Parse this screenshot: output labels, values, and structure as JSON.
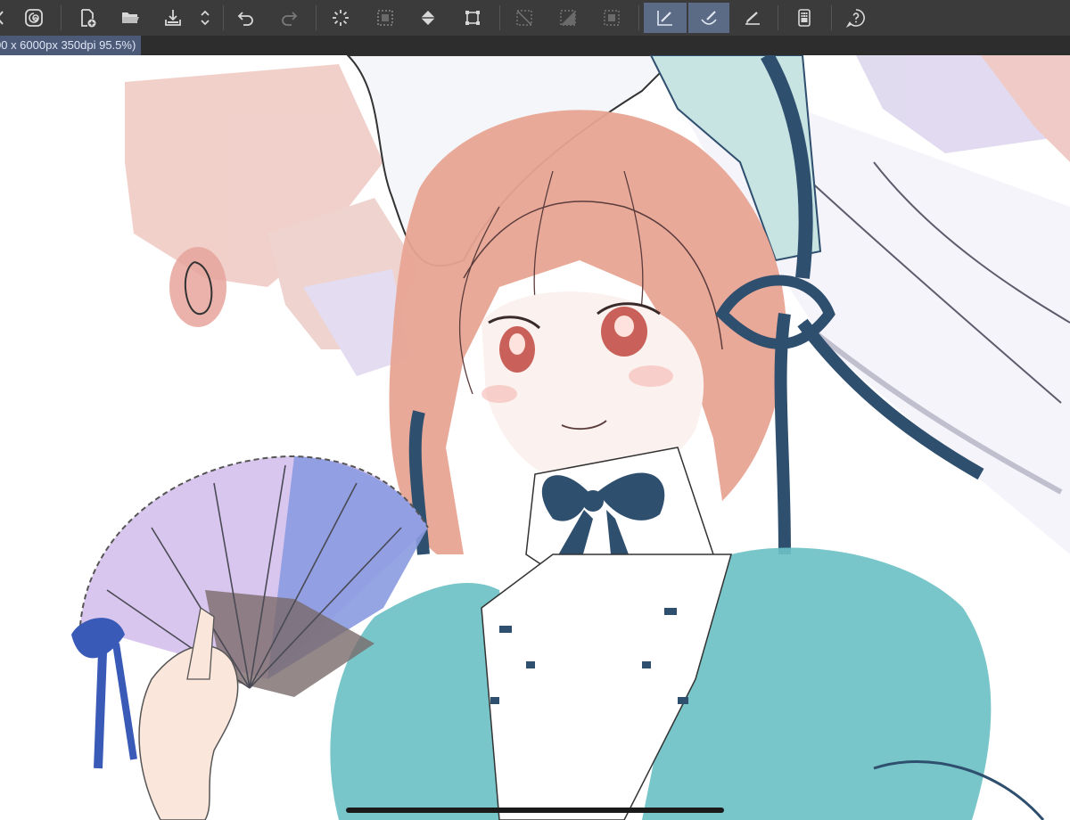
{
  "toolbar": {
    "buttons": [
      {
        "name": "clip-studio-icon",
        "label": "Clip Studio"
      },
      {
        "name": "new-file-icon",
        "label": "New"
      },
      {
        "name": "open-folder-icon",
        "label": "Open"
      },
      {
        "name": "save-icon",
        "label": "Save"
      },
      {
        "name": "undo-icon",
        "label": "Undo"
      },
      {
        "name": "redo-icon",
        "label": "Redo"
      },
      {
        "name": "clear-selection-icon",
        "label": "Clear"
      },
      {
        "name": "select-all-icon",
        "label": "Select all"
      },
      {
        "name": "fill-icon",
        "label": "Fill"
      },
      {
        "name": "transform-icon",
        "label": "Transform"
      },
      {
        "name": "snap-off-icon",
        "label": "Snap off"
      },
      {
        "name": "snap-ruler-icon",
        "label": "Snap to ruler"
      },
      {
        "name": "snap-grid-icon",
        "label": "Snap to grid"
      },
      {
        "name": "pen-pressure-icon",
        "label": "Pen"
      },
      {
        "name": "brush-icon",
        "label": "Brush"
      },
      {
        "name": "ruler-icon",
        "label": "Ruler"
      },
      {
        "name": "companion-mode-icon",
        "label": "Companion mode"
      },
      {
        "name": "help-icon",
        "label": "Help"
      }
    ]
  },
  "canvas": {
    "info": "00 x 6000px 350dpi 95.5%)"
  },
  "colors": {
    "toolbar_bg": "#3b3b3b",
    "active_button": "#5b6b86",
    "info_bg": "#4c5a78",
    "hair": "#e8a493",
    "dress": "#6cc1c4",
    "ribbon": "#2f4f6e",
    "fan": "#b9a4e0"
  }
}
